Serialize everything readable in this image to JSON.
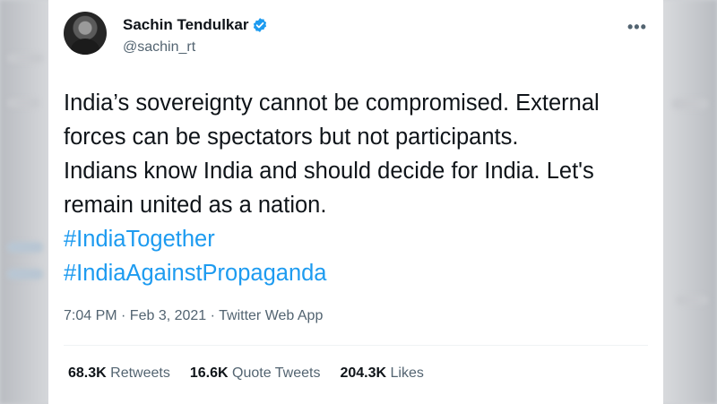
{
  "tweet": {
    "author_name": "Sachin Tendulkar",
    "handle": "@sachin_rt",
    "more_label": "•••",
    "text_lines": [
      "India’s sovereignty cannot be compromised. External",
      "forces can be spectators but not participants.",
      "Indians know India and should decide for India. Let's",
      "remain united as a nation."
    ],
    "hashtags": [
      "#IndiaTogether",
      "#IndiaAgainstPropaganda"
    ],
    "timestamp": "7:04 PM · Feb 3, 2021 · Twitter Web App",
    "stats": {
      "retweets_count": "68.3K",
      "retweets_label": "Retweets",
      "quote_count": "16.6K",
      "quote_label": "Quote Tweets",
      "likes_count": "204.3K",
      "likes_label": "Likes"
    }
  },
  "colors": {
    "text": "#0f1419",
    "muted": "#536471",
    "link": "#1d9bf0",
    "verified": "#1d9bf0"
  },
  "icons": {
    "verified": "verified-badge-icon",
    "more": "more-options-icon"
  }
}
